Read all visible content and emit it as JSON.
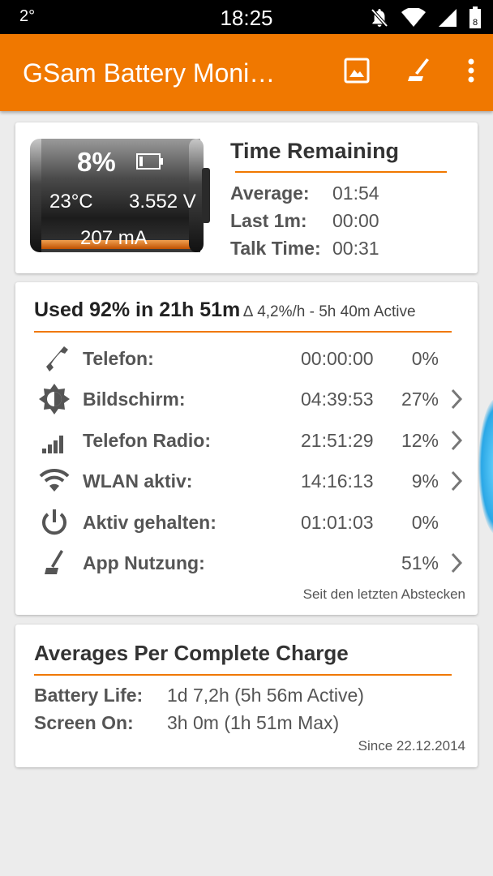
{
  "status_bar": {
    "temperature": "2°",
    "time": "18:25",
    "battery_level": "8"
  },
  "app_bar": {
    "title": "GSam Battery Moni…",
    "icons": [
      "image-icon",
      "app-usage-icon",
      "overflow-menu-icon"
    ]
  },
  "battery": {
    "percent": "8%",
    "temperature": "23°C",
    "voltage": "3.552 V",
    "current": "207 mA",
    "fill_fraction": 0.08
  },
  "time_remaining": {
    "title": "Time Remaining",
    "rows": [
      {
        "label": "Average:",
        "value": "01:54"
      },
      {
        "label": "Last 1m:",
        "value": "00:00"
      },
      {
        "label": "Talk Time:",
        "value": "00:31"
      }
    ]
  },
  "usage": {
    "title": "Used 92% in 21h 51m",
    "subtitle": "∆ 4,2%/h - 5h 40m Active",
    "rows": [
      {
        "icon": "phone-icon",
        "label": "Telefon:",
        "time": "00:00:00",
        "percent": "0%",
        "has_chevron": false
      },
      {
        "icon": "brightness-icon",
        "label": "Bildschirm:",
        "time": "04:39:53",
        "percent": "27%",
        "has_chevron": true
      },
      {
        "icon": "signal-bars-icon",
        "label": "Telefon Radio:",
        "time": "21:51:29",
        "percent": "12%",
        "has_chevron": true
      },
      {
        "icon": "wifi-icon",
        "label": "WLAN aktiv:",
        "time": "14:16:13",
        "percent": "9%",
        "has_chevron": true
      },
      {
        "icon": "power-icon",
        "label": "Aktiv gehalten:",
        "time": "01:01:03",
        "percent": "0%",
        "has_chevron": false
      },
      {
        "icon": "app-usage-icon",
        "label": "App Nutzung:",
        "time": "",
        "percent": "51%",
        "has_chevron": true
      }
    ],
    "footnote": "Seit den letzten Abstecken"
  },
  "averages": {
    "title": "Averages Per Complete Charge",
    "rows": [
      {
        "label": "Battery Life:",
        "value": "1d 7,2h (5h 56m Active)"
      },
      {
        "label": "Screen On:",
        "value": "3h 0m (1h 51m Max)"
      }
    ],
    "footnote": "Since 22.12.2014"
  },
  "colors": {
    "accent": "#f07800",
    "background": "#ececec"
  }
}
